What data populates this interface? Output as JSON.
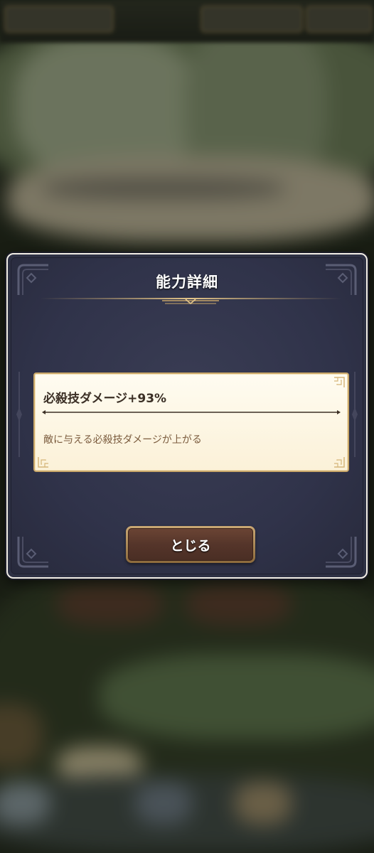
{
  "dialog": {
    "title": "能力詳細",
    "ability_name": "必殺技ダメージ+93%",
    "ability_description": "敵に与える必殺技ダメージが上がる",
    "close_label": "とじる"
  },
  "colors": {
    "dialog_background": "#30334a",
    "card_background": "#fdf6e4",
    "card_border": "#caa86a",
    "heading_text": "#3b2f25",
    "description_text": "#7b5c3e",
    "button_face": "#55352a",
    "button_rim": "#b48f5c"
  }
}
